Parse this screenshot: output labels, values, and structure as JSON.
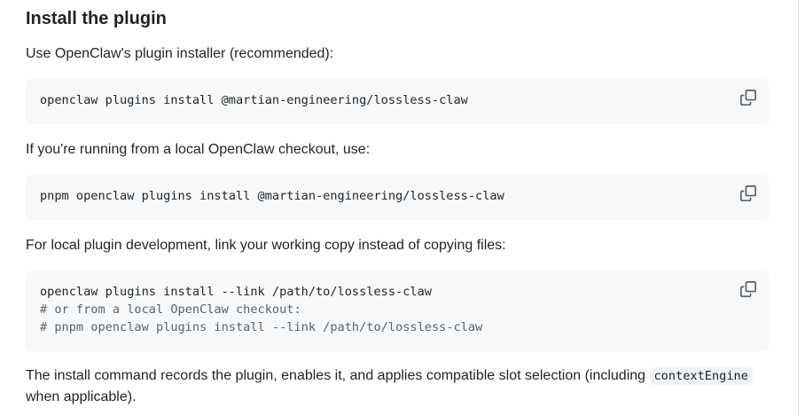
{
  "section": {
    "heading": "Install the plugin",
    "intro": "Use OpenClaw's plugin installer (recommended):",
    "local_intro": "If you're running from a local OpenClaw checkout, use:",
    "dev_intro": "For local plugin development, link your working copy instead of copying files:",
    "summary_before": "The install command records the plugin, enables it, and applies compatible slot selection (including ",
    "summary_code": "contextEngine",
    "summary_after": " when applicable)."
  },
  "code_blocks": [
    {
      "lines": [
        "openclaw plugins install @martian-engineering/lossless-claw"
      ]
    },
    {
      "lines": [
        "pnpm openclaw plugins install @martian-engineering/lossless-claw"
      ]
    },
    {
      "lines": [
        "openclaw plugins install --link /path/to/lossless-claw",
        "# or from a local OpenClaw checkout:",
        "# pnpm openclaw plugins install --link /path/to/lossless-claw"
      ]
    }
  ],
  "icons": {
    "copy": "copy-icon"
  },
  "colors": {
    "text": "#1f2328",
    "code_background": "#f6f8fa",
    "comment": "#59636e",
    "icon": "#59636e"
  }
}
